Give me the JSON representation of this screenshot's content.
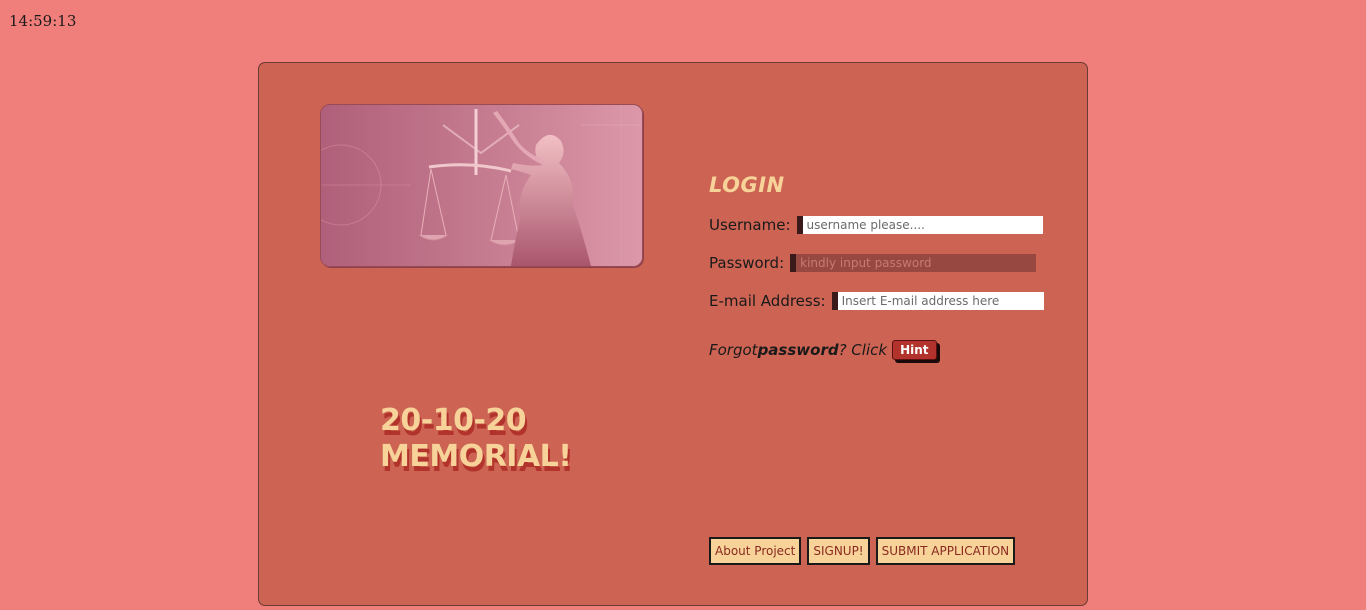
{
  "clock": {
    "time": "14:59:13"
  },
  "banner": {
    "line1": "20-10-20",
    "line2": "MEMORIAL!"
  },
  "login": {
    "title": "LOGIN",
    "username": {
      "label": "Username:",
      "placeholder": "username please...."
    },
    "password": {
      "label": "Password:",
      "placeholder": "kindly input password"
    },
    "email": {
      "label": "E-mail Address:",
      "placeholder": "Insert E-mail address here"
    },
    "forgot": {
      "prefix": "Forgot ",
      "bold": "password",
      "suffix": "? Click",
      "hint_label": "Hint"
    }
  },
  "actions": {
    "about_label": "About Project",
    "signup_label": "SIGNUP!",
    "submit_label": "SUBMIT APPLICATION"
  },
  "colors": {
    "page_bg": "#f07f7b",
    "card_bg": "#cc6353",
    "accent_text": "#f7d39a",
    "shadow_red": "#b2332b"
  },
  "icons": {
    "hero_image": "lady-justice-statue-image"
  }
}
